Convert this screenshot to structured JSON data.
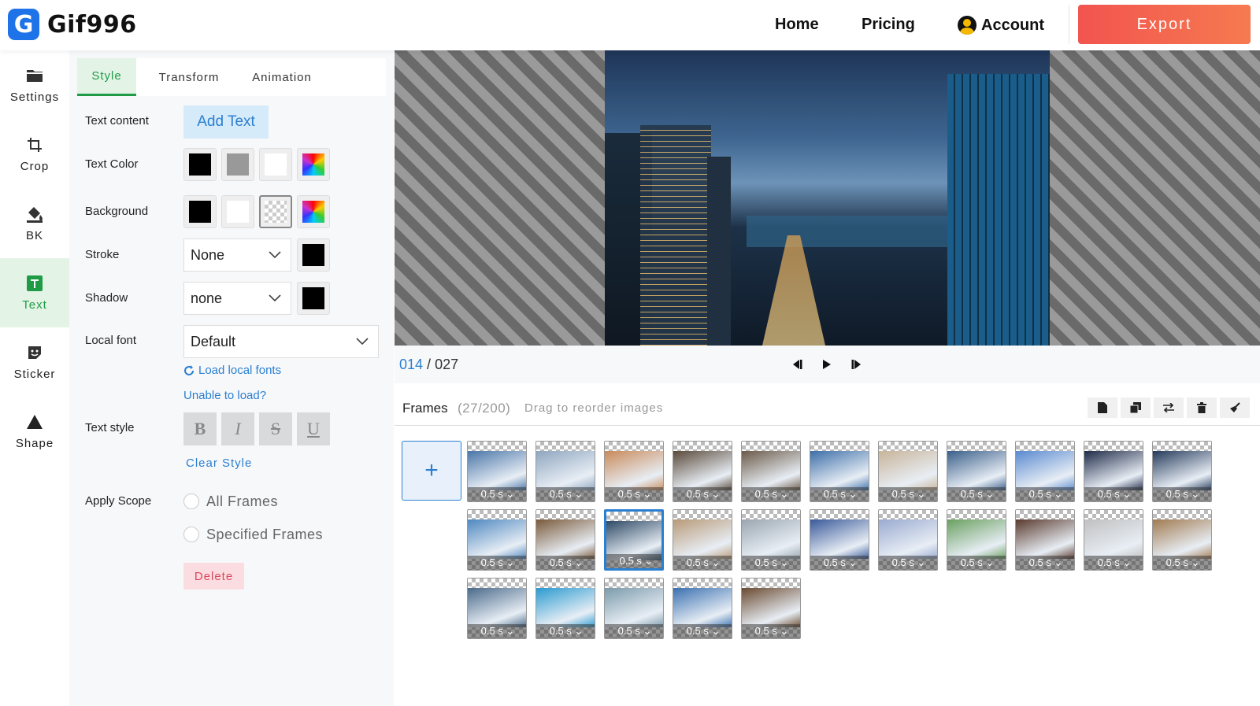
{
  "app": {
    "logo_letter": "G",
    "name": "Gif996"
  },
  "nav": {
    "home": "Home",
    "pricing": "Pricing",
    "account": "Account",
    "export": "Export"
  },
  "rail": [
    {
      "label": "Settings",
      "icon": "settings-folder-icon"
    },
    {
      "label": "Crop",
      "icon": "crop-icon"
    },
    {
      "label": "BK",
      "icon": "paint-bucket-icon"
    },
    {
      "label": "Text",
      "icon": "text-icon",
      "active": true
    },
    {
      "label": "Sticker",
      "icon": "sticker-icon"
    },
    {
      "label": "Shape",
      "icon": "triangle-icon"
    }
  ],
  "tabs": {
    "style": "Style",
    "transform": "Transform",
    "animation": "Animation",
    "active": "Style"
  },
  "form": {
    "text_content_label": "Text content",
    "add_text": "Add Text",
    "text_color_label": "Text Color",
    "text_colors": [
      "#000000",
      "#999999",
      "#ffffff",
      "rainbow"
    ],
    "background_label": "Background",
    "background_colors": [
      "#000000",
      "#ffffff",
      "transparent",
      "rainbow"
    ],
    "background_selected": "transparent",
    "stroke_label": "Stroke",
    "stroke_value": "None",
    "stroke_color": "#000000",
    "shadow_label": "Shadow",
    "shadow_value": "none",
    "shadow_color": "#000000",
    "local_font_label": "Local font",
    "local_font_value": "Default",
    "load_local_fonts": "Load local fonts",
    "unable_to_load": "Unable to load?",
    "text_style_label": "Text style",
    "style_buttons": [
      "B",
      "I",
      "S",
      "U"
    ],
    "clear_style": "Clear Style",
    "apply_scope_label": "Apply Scope",
    "scope_all": "All Frames",
    "scope_specified": "Specified Frames",
    "delete": "Delete"
  },
  "player": {
    "current": "014",
    "separator": " / ",
    "total": "027"
  },
  "frames": {
    "title": "Frames",
    "count": "(27/200)",
    "hint": "Drag to reorder images",
    "add": "+",
    "duration_label": "0.5 s",
    "selected_index": 13,
    "items": [
      "#4a76a8",
      "#8fa6bf",
      "#c98a5a",
      "#5a4a3a",
      "#6b5a48",
      "#3d6fa8",
      "#c8b49a",
      "#3a5f8a",
      "#5a8ad0",
      "#1e2a48",
      "#243a5a",
      "#4f88c0",
      "#7a5a3a",
      "#2e4a66",
      "#b89a78",
      "#9aa6b0",
      "#3a5a9a",
      "#9aaad0",
      "#6aa060",
      "#5a3a2e",
      "#c0c0c0",
      "#a07a50",
      "#4a6a8a",
      "#2a9ad0",
      "#7a9aaa",
      "#3a70b0",
      "#6a4a30"
    ]
  },
  "colors": {
    "accent": "#1f9b46",
    "link": "#2b7fd1",
    "export_start": "#f2544f",
    "export_end": "#f67a50"
  }
}
